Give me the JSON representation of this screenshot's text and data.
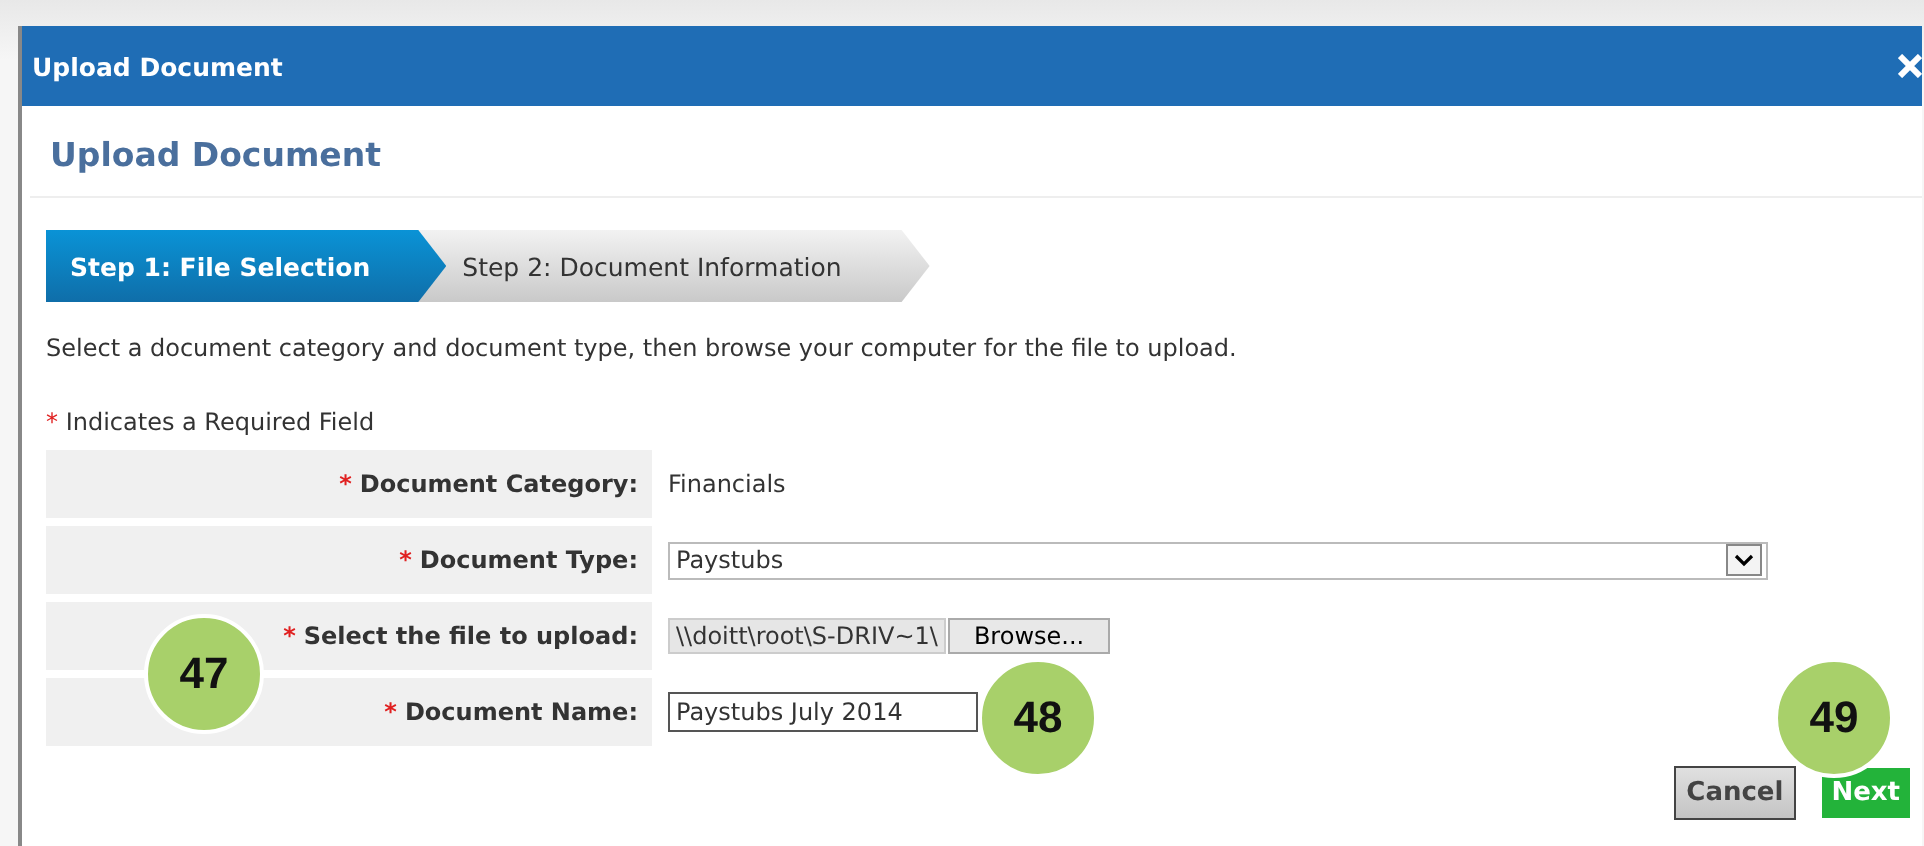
{
  "window": {
    "title": "Upload Document"
  },
  "heading": "Upload Document",
  "steps": [
    {
      "label": "Step 1: File Selection",
      "selected": true
    },
    {
      "label": "Step 2: Document Information",
      "selected": false
    }
  ],
  "instruction": "Select a document category and document type, then browse your computer for the file to upload.",
  "required_note": {
    "mark": "*",
    "text": "Indicates a Required Field"
  },
  "fields": [
    {
      "kind": "text",
      "mark": "*",
      "label": "Document Category:",
      "value": "Financials"
    },
    {
      "kind": "select",
      "mark": "*",
      "label": "Document Type:",
      "value": "Paystubs"
    },
    {
      "kind": "file",
      "mark": "*",
      "label": "Select the file to upload:",
      "value": "\\\\doitt\\root\\S-DRIV~1\\",
      "button": "Browse..."
    },
    {
      "kind": "input",
      "mark": "*",
      "label": "Document Name:",
      "value": "Paystubs July 2014"
    }
  ],
  "buttons": [
    {
      "kind": "cancel",
      "label": "Cancel"
    },
    {
      "kind": "next",
      "label": "Next"
    }
  ],
  "callouts": [
    {
      "number": "47"
    },
    {
      "number": "48"
    },
    {
      "number": "49"
    }
  ]
}
